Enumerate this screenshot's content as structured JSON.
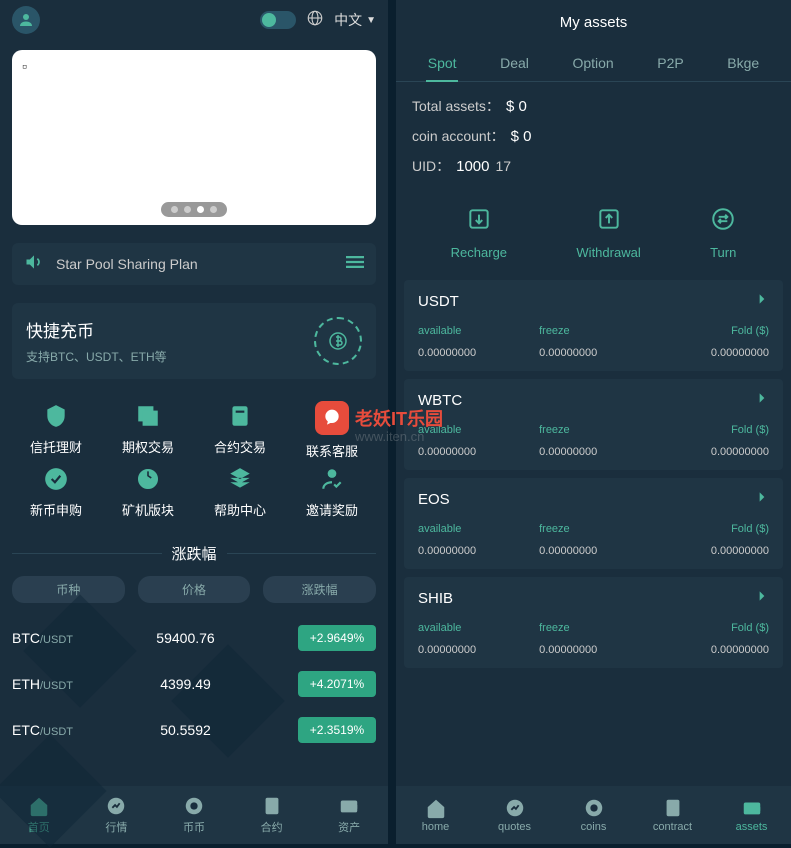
{
  "lang": "中文",
  "announcement": "Star Pool Sharing Plan",
  "deposit": {
    "title": "快捷充币",
    "sub": "支持BTC、USDT、ETH等"
  },
  "menu": [
    {
      "label": "信托理财"
    },
    {
      "label": "期权交易"
    },
    {
      "label": "合约交易"
    },
    {
      "label": "联系客服"
    },
    {
      "label": "新币申购"
    },
    {
      "label": "矿机版块"
    },
    {
      "label": "帮助中心"
    },
    {
      "label": "邀请奖励"
    }
  ],
  "watermark": {
    "top": "老妖IT乐园",
    "bottom": "www.iten.cn"
  },
  "market": {
    "title": "涨跌幅",
    "cols": [
      "币种",
      "价格",
      "涨跌幅"
    ],
    "rows": [
      {
        "base": "BTC",
        "quote": "/USDT",
        "price": "59400.76",
        "change": "+2.9649%"
      },
      {
        "base": "ETH",
        "quote": "/USDT",
        "price": "4399.49",
        "change": "+4.2071%"
      },
      {
        "base": "ETC",
        "quote": "/USDT",
        "price": "50.5592",
        "change": "+2.3519%"
      }
    ]
  },
  "left_nav": [
    {
      "label": "首页"
    },
    {
      "label": "行情"
    },
    {
      "label": "币币"
    },
    {
      "label": "合约"
    },
    {
      "label": "资产"
    }
  ],
  "right": {
    "title": "My assets",
    "tabs": [
      "Spot",
      "Deal",
      "Option",
      "P2P",
      "Bkge"
    ],
    "total_label": "Total assets：",
    "total_value": "$ 0",
    "coin_label": "coin account：",
    "coin_value": "$ 0",
    "uid_label": "UID：",
    "uid_value": "1000",
    "uid_suffix": "17",
    "actions": [
      "Recharge",
      "Withdrawal",
      "Turn"
    ],
    "asset_cols": {
      "a": "available",
      "b": "freeze",
      "c": "Fold ($)"
    },
    "zero": "0.00000000",
    "assets": [
      "USDT",
      "WBTC",
      "EOS",
      "SHIB"
    ]
  },
  "right_nav": [
    {
      "label": "home"
    },
    {
      "label": "quotes"
    },
    {
      "label": "coins"
    },
    {
      "label": "contract"
    },
    {
      "label": "assets"
    }
  ]
}
